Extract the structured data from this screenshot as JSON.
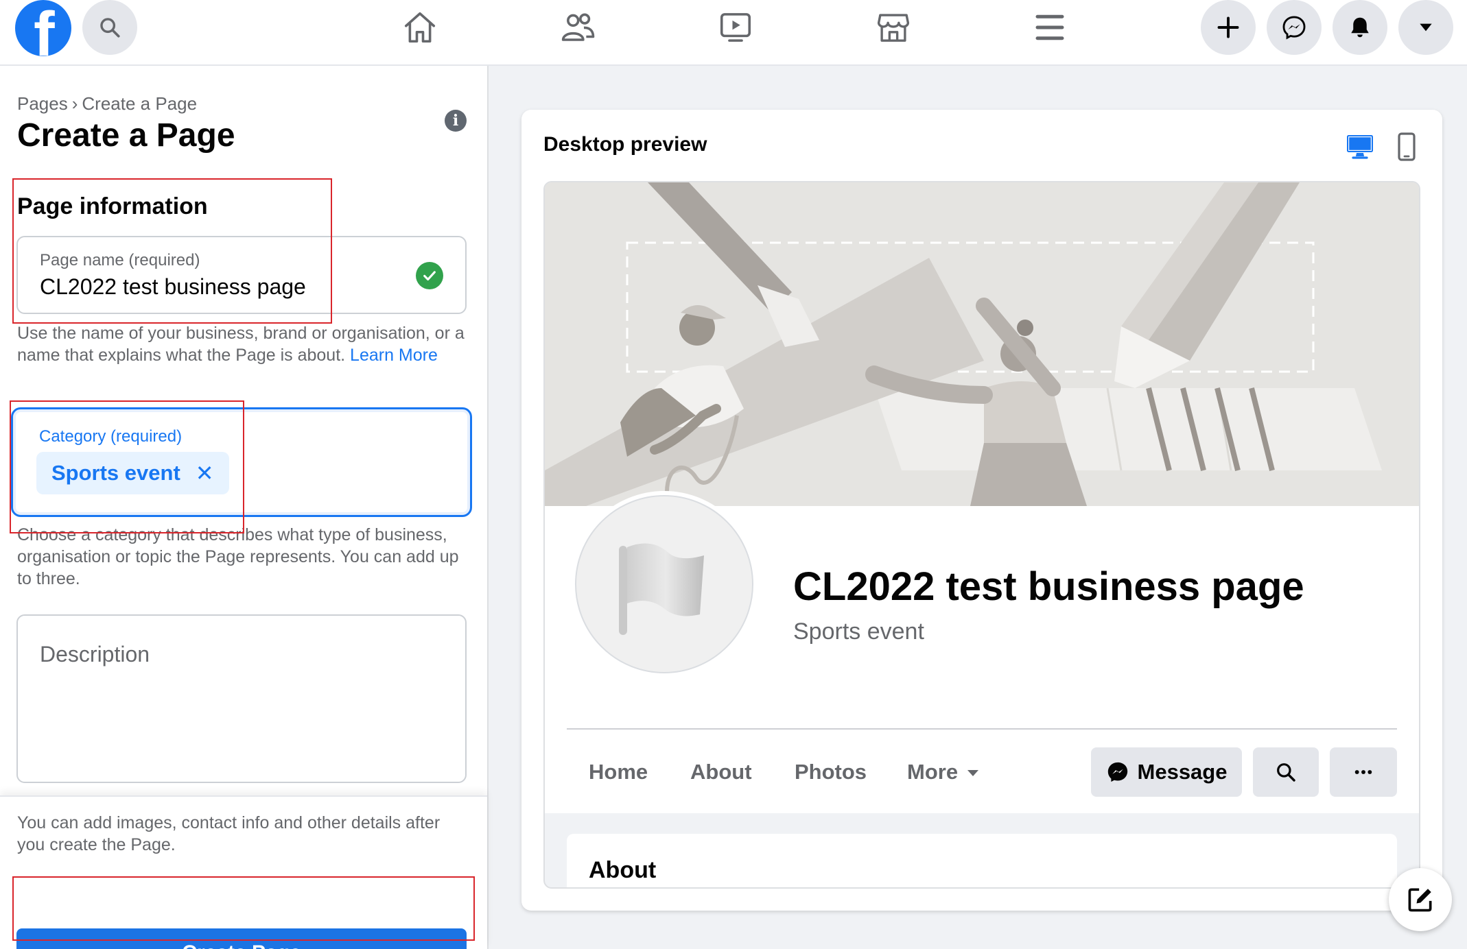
{
  "nav": {
    "logo_letter": "f",
    "icons": [
      "search-icon",
      "home-icon",
      "friends-icon",
      "watch-icon",
      "marketplace-icon",
      "menu-icon",
      "plus-icon",
      "messenger-icon",
      "bell-icon",
      "caret-down-icon"
    ]
  },
  "breadcrumb": {
    "root": "Pages",
    "separator": "›",
    "current": "Create a Page"
  },
  "page_title": "Create a Page",
  "section_title": "Page information",
  "page_name": {
    "label": "Page name (required)",
    "value": "CL2022 test business page",
    "helper_text": "Use the name of your business, brand or organisation, or a name that explains what the Page is about.",
    "helper_link": "Learn More"
  },
  "category": {
    "label": "Category (required)",
    "selected": "Sports event",
    "remove_symbol": "✕",
    "helper_text": "Choose a category that describes what type of business, organisation or topic the Page represents. You can add up to three."
  },
  "description": {
    "placeholder": "Description"
  },
  "footer": {
    "note": "You can add images, contact info and other details after you create the Page.",
    "create_button": "Create Page"
  },
  "preview": {
    "title": "Desktop preview",
    "page_name": "CL2022 test business page",
    "page_category": "Sports event",
    "tabs": [
      "Home",
      "About",
      "Photos",
      "More"
    ],
    "message_button": "Message",
    "about_heading": "About"
  },
  "colors": {
    "brand": "#1877f2",
    "button": "#1b74e4",
    "annotation": "#d9252b",
    "success": "#31a24c"
  }
}
